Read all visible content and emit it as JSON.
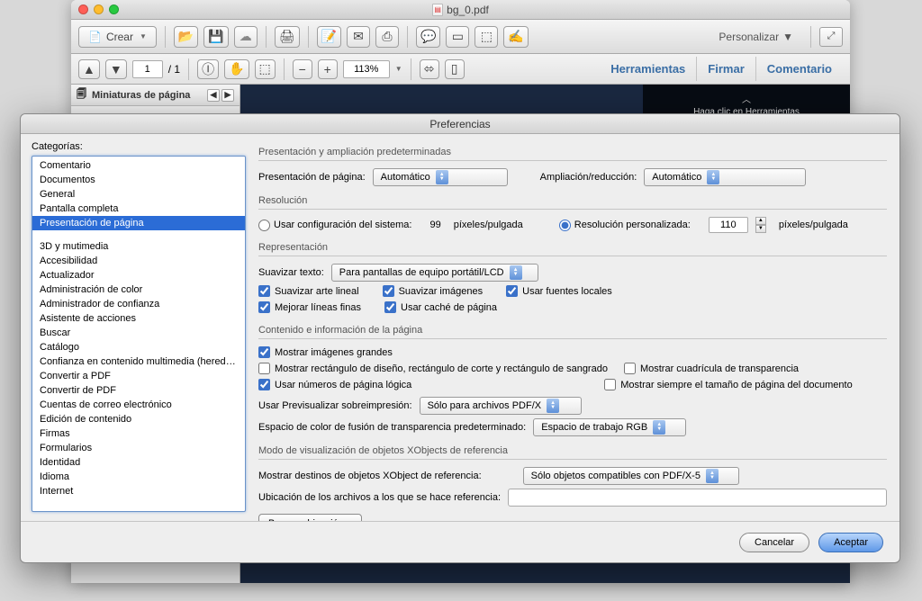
{
  "window": {
    "title": "bg_0.pdf"
  },
  "toolbar1": {
    "crear": "Crear",
    "personalizar": "Personalizar"
  },
  "toolbar2": {
    "page_current": "1",
    "page_total": "/ 1",
    "zoom": "113%",
    "herramientas": "Herramientas",
    "firmar": "Firmar",
    "comentario": "Comentario"
  },
  "thumbnails": {
    "title": "Miniaturas de página"
  },
  "hint": {
    "chevron": "︿",
    "text": "Haga clic en Herramientas"
  },
  "dialog": {
    "title": "Preferencias",
    "footer": {
      "cancel": "Cancelar",
      "ok": "Aceptar"
    }
  },
  "categories": {
    "label": "Categorías:",
    "group1": [
      "Comentario",
      "Documentos",
      "General",
      "Pantalla completa",
      "Presentación de página"
    ],
    "group2": [
      "3D y mutimedia",
      "Accesibilidad",
      "Actualizador",
      "Administración de color",
      "Administrador de confianza",
      "Asistente de acciones",
      "Buscar",
      "Catálogo",
      "Confianza en contenido multimedia (heredado)",
      "Convertir a PDF",
      "Convertir de PDF",
      "Cuentas de correo electrónico",
      "Edición de contenido",
      "Firmas",
      "Formularios",
      "Identidad",
      "Idioma",
      "Internet"
    ],
    "selected": "Presentación de página"
  },
  "sections": {
    "s1": {
      "title": "Presentación y ampliación predeterminadas",
      "presentacion_label": "Presentación de página:",
      "presentacion_value": "Automático",
      "ampliacion_label": "Ampliación/reducción:",
      "ampliacion_value": "Automático"
    },
    "s2": {
      "title": "Resolución",
      "usar_config": "Usar configuración del sistema:",
      "sys_value": "99",
      "sys_unit": "píxeles/pulgada",
      "res_pers": "Resolución personalizada:",
      "pers_value": "110",
      "pers_unit": "píxeles/pulgada"
    },
    "s3": {
      "title": "Representación",
      "suavizar_texto": "Suavizar texto:",
      "suavizar_texto_value": "Para pantallas de equipo portátil/LCD",
      "cb_arte": "Suavizar arte lineal",
      "cb_img": "Suavizar imágenes",
      "cb_fuentes": "Usar fuentes locales",
      "cb_lineas": "Mejorar líneas finas",
      "cb_cache": "Usar caché de página"
    },
    "s4": {
      "title": "Contenido e información de la página",
      "cb_grandes": "Mostrar imágenes grandes",
      "cb_rect": "Mostrar rectángulo de diseño, rectángulo de corte y rectángulo de sangrado",
      "cb_cuadricula": "Mostrar cuadrícula de transparencia",
      "cb_numeros": "Usar números de página lógica",
      "cb_tamano": "Mostrar siempre el tamaño de página del documento",
      "prev_label": "Usar Previsualizar sobreimpresión:",
      "prev_value": "Sólo para archivos PDF/X",
      "espacio_label": "Espacio de color de fusión de transparencia predeterminado:",
      "espacio_value": "Espacio de trabajo RGB"
    },
    "s5": {
      "title": "Modo de visualización de objetos XObjects de referencia",
      "mostrar_label": "Mostrar destinos de objetos XObject de referencia:",
      "mostrar_value": "Sólo objetos compatibles con PDF/X-5",
      "ubicacion_label": "Ubicación de los archivos a los que se hace referencia:",
      "ubicacion_value": "",
      "browse": "Buscar ubicación..."
    }
  }
}
